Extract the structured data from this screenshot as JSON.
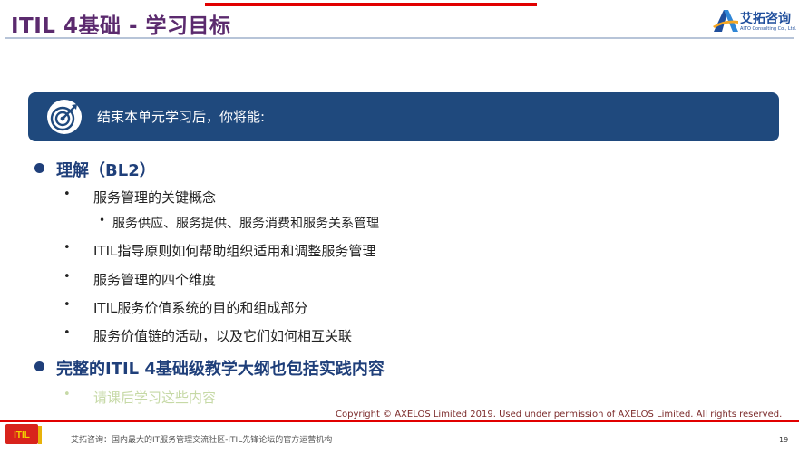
{
  "slide": {
    "title": "ITIL 4基础 - 学习目标",
    "page_number": "19"
  },
  "logo": {
    "name": "艾拓咨询",
    "tagline": "AITO Consulting Co., Ltd."
  },
  "banner": {
    "icon": "target-icon",
    "text": "结束本单元学习后，你将能:"
  },
  "content": {
    "section1": {
      "heading": "理解（BL2）",
      "items": [
        {
          "text": "服务管理的关键概念",
          "subitems": [
            {
              "text": "服务供应、服务提供、服务消费和服务关系管理"
            }
          ]
        },
        {
          "text": "ITIL指导原则如何帮助组织适用和调整服务管理"
        },
        {
          "text": "服务管理的四个维度"
        },
        {
          "text": "ITIL服务价值系统的目的和组成部分"
        },
        {
          "text": "服务价值链的活动，以及它们如何相互关联"
        }
      ]
    },
    "section2": {
      "heading": "完整的ITIL 4基础级教学大纲也包括实践内容",
      "items": [
        {
          "text": "请课后学习这些内容"
        }
      ]
    }
  },
  "copyright": "Copyright © AXELOS Limited 2019. Used under permission of AXELOS Limited. All rights reserved.",
  "footer": {
    "badge": "ITIL",
    "text": "艾拓咨询：国内最大的IT服务管理交流社区-ITIL先锋论坛的官方运营机构"
  },
  "bullets": {
    "level1": "●",
    "level2": "•",
    "level3": "•"
  },
  "colors": {
    "title": "#5b2a6e",
    "banner": "#1f497d",
    "heading": "#1f3f7a",
    "accent_red": "#e10000",
    "muted_text": "#c6d9a6",
    "logo_blue": "#1f4e9c",
    "logo_orange": "#f5a623"
  }
}
